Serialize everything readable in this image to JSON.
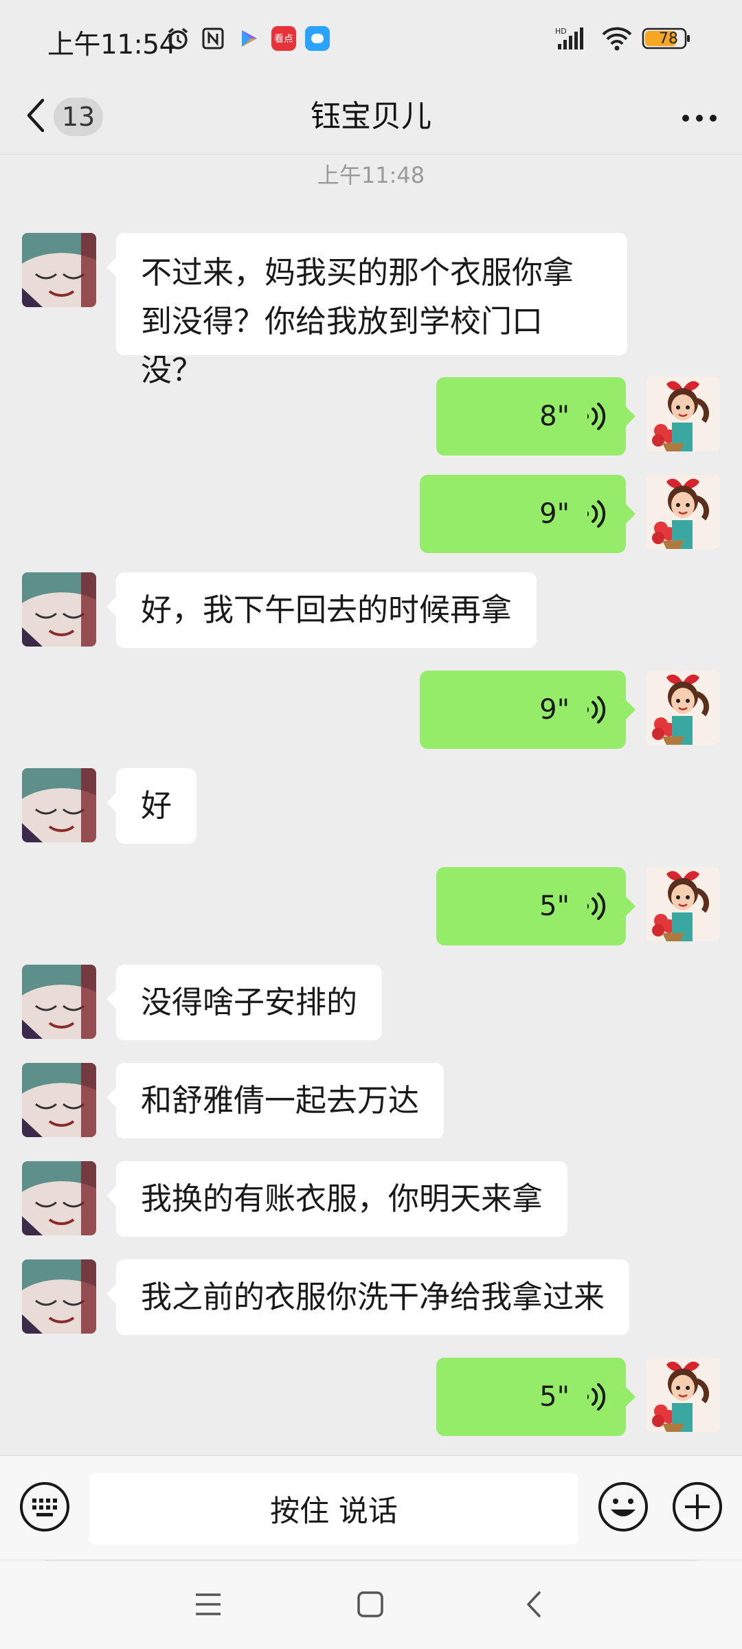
{
  "status_bar": {
    "time": "上午11:54",
    "battery": "78",
    "network": "HD"
  },
  "nav": {
    "back_badge": "13",
    "title": "钰宝贝儿"
  },
  "timestamp": "上午11:48",
  "messages": {
    "m1": "不过来，妈我买的那个衣服你拿到没得？你给我放到学校门口没？",
    "v1": "8\"",
    "v2": "9\"",
    "m2": "好，我下午回去的时候再拿",
    "v3": "9\"",
    "m3": "好",
    "v4": "5\"",
    "m4": "没得啥子安排的",
    "m5": "和舒雅倩一起去万达",
    "m6": "我换的有账衣服，你明天来拿",
    "m7": "我之前的衣服你洗干净给我拿过来",
    "v5": "5\""
  },
  "input_bar": {
    "talk_label": "按住 说话"
  },
  "colors": {
    "background": "#ededed",
    "outgoing_bubble": "#95ec69",
    "incoming_bubble": "#ffffff"
  },
  "icons": [
    "alarm-icon",
    "nfc-icon",
    "signal-icon",
    "wifi-icon",
    "battery-icon",
    "back-chevron-icon",
    "more-icon",
    "voice-icon",
    "keyboard-icon",
    "emoji-icon",
    "plus-icon",
    "menu-icon",
    "home-icon",
    "back-icon"
  ]
}
